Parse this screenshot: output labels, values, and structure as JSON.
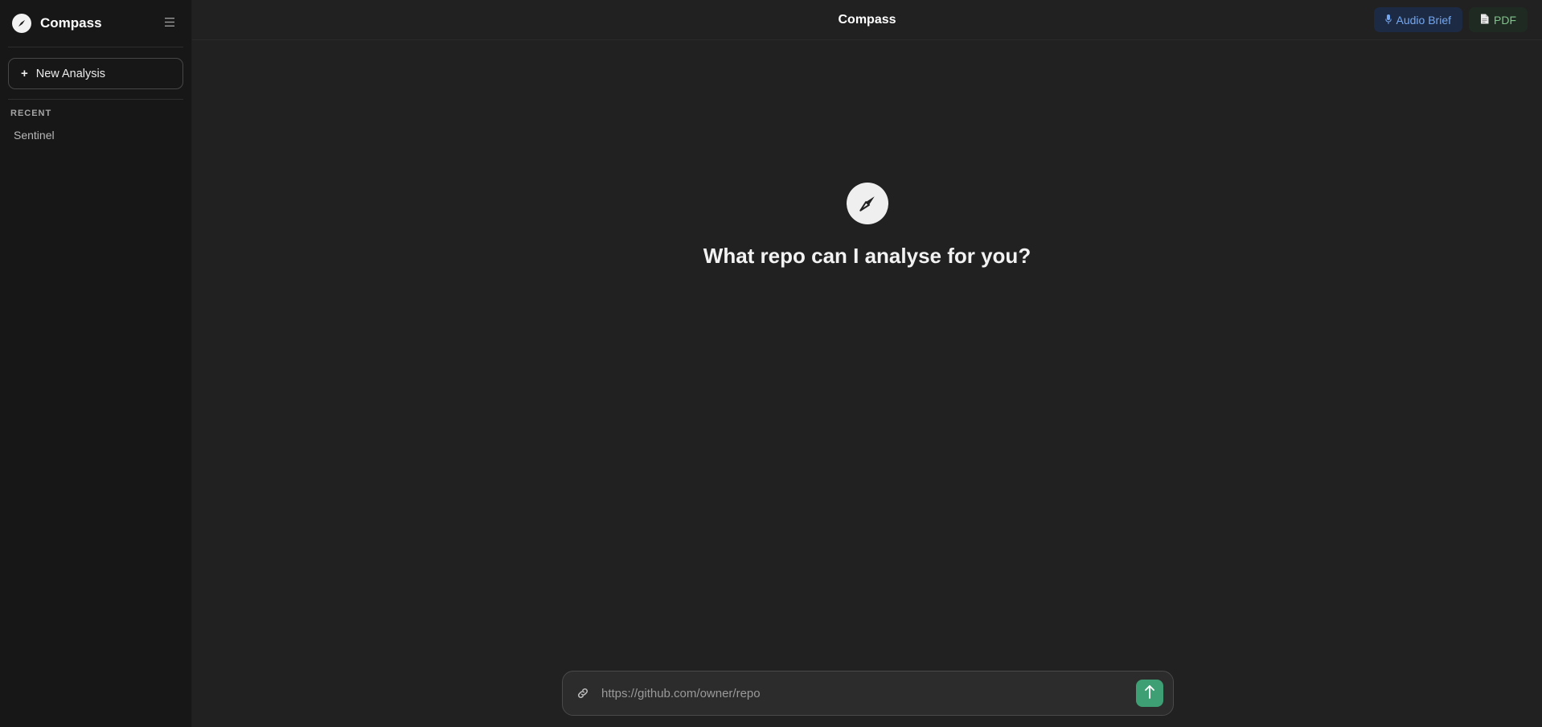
{
  "sidebar": {
    "brand": "Compass",
    "new_analysis_label": "New Analysis",
    "new_analysis_icon": "+",
    "recent_label": "RECENT",
    "recent_items": [
      "Sentinel"
    ]
  },
  "header": {
    "title": "Compass",
    "audio_label": "Audio Brief",
    "pdf_label": "PDF"
  },
  "hero": {
    "prompt": "What repo can I analyse for you?"
  },
  "input": {
    "placeholder": "https://github.com/owner/repo",
    "value": ""
  },
  "colors": {
    "accent_green": "#3e9e74",
    "audio_text": "#74a7ef",
    "pdf_text": "#7fc48a",
    "background": "#212121",
    "sidebar_bg": "#171717"
  }
}
